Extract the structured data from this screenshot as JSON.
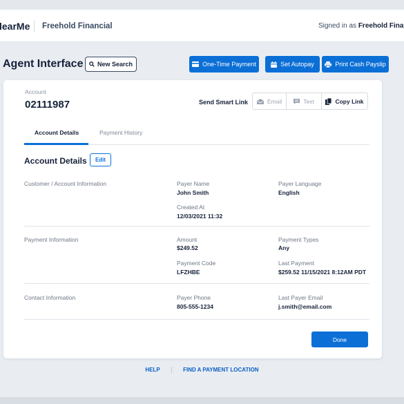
{
  "header": {
    "logo": "learMe",
    "org": "Freehold Financial",
    "signed_prefix": "Signed in as",
    "signed_name": "Freehold Financ"
  },
  "toolbar": {
    "title": "Agent Interface",
    "new_search": "New Search",
    "one_time_payment": "One-Time Payment",
    "set_autopay": "Set Autopay",
    "print_payslip": "Print Cash Payslip"
  },
  "account": {
    "label": "Account",
    "number": "02111987",
    "smart_link_label": "Send Smart Link",
    "email": "Email",
    "text": "Text",
    "copy_link": "Copy Link"
  },
  "tabs": [
    {
      "label": "Account Details",
      "active": true
    },
    {
      "label": "Payment History",
      "active": false
    }
  ],
  "details": {
    "heading": "Account Details",
    "edit": "Edit",
    "sections": [
      {
        "title": "Customer / Account Information",
        "fields": [
          {
            "label": "Payer Name",
            "value": "John Smith"
          },
          {
            "label": "Payer Language",
            "value": "English"
          },
          {
            "label": "Created At",
            "value": "12/03/2021 11:32"
          }
        ]
      },
      {
        "title": "Payment Information",
        "fields": [
          {
            "label": "Amount",
            "value": "$249.52"
          },
          {
            "label": "Payment Types",
            "value": "Any"
          },
          {
            "label": "Payment Code",
            "value": "LFZHBE"
          },
          {
            "label": "Last Payment",
            "value": "$259.52 11/15/2021 8:12AM PDT"
          }
        ]
      },
      {
        "title": "Contact Information",
        "fields": [
          {
            "label": "Payer Phone",
            "value": "805-555-1234"
          },
          {
            "label": "Last Payer Email",
            "value": "j.smith@email.com"
          }
        ]
      }
    ],
    "done": "Done"
  },
  "footer": {
    "help": "HELP",
    "find_location": "FIND A PAYMENT LOCATION"
  },
  "colors": {
    "accent": "#0b6fd6",
    "dark_text": "#16213a",
    "background": "#e9edf2"
  },
  "icons": [
    "search-icon",
    "payment-card-icon",
    "calendar-icon",
    "printer-icon",
    "envelope-icon",
    "chat-icon",
    "copy-icon"
  ]
}
